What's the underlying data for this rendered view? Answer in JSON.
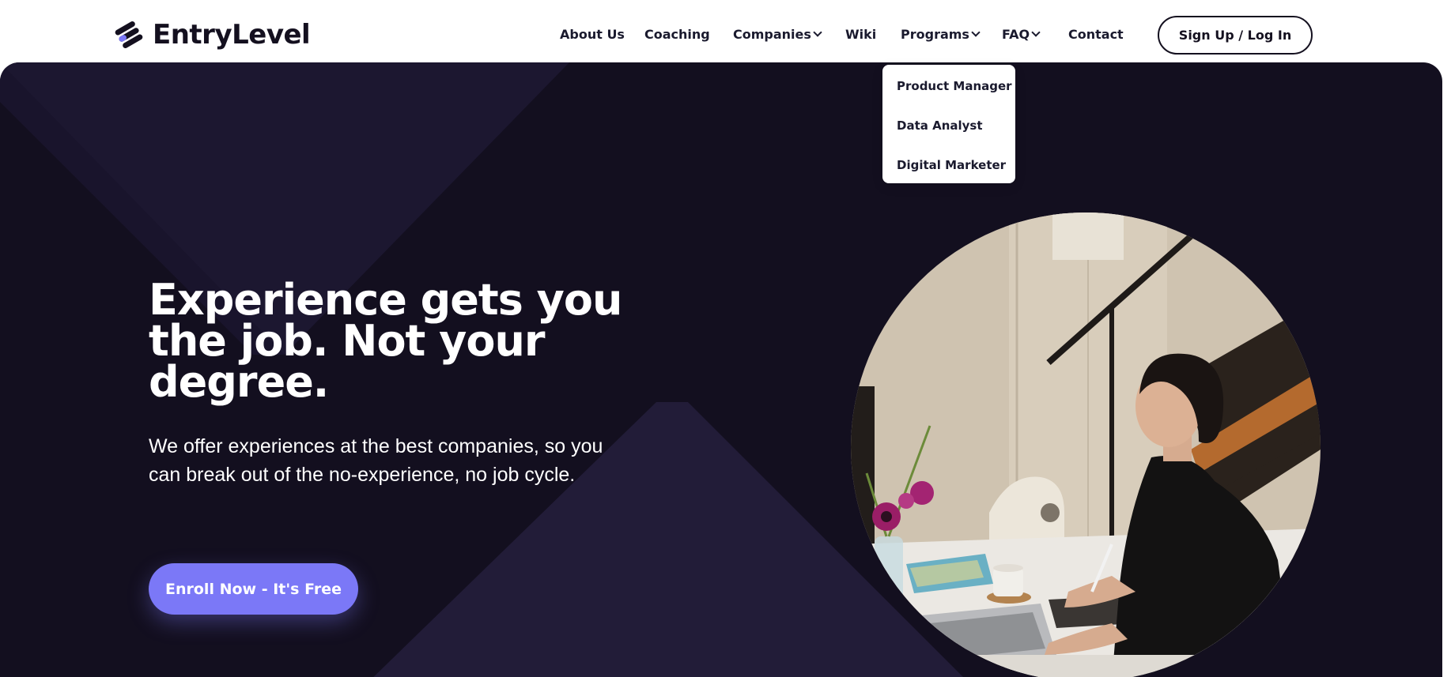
{
  "brand": {
    "name": "EntryLevel"
  },
  "nav": {
    "items": [
      {
        "label": "About Us",
        "has_dropdown": false
      },
      {
        "label": "Coaching",
        "has_dropdown": false
      },
      {
        "label": "Companies",
        "has_dropdown": true
      },
      {
        "label": "Wiki",
        "has_dropdown": false
      },
      {
        "label": "Programs",
        "has_dropdown": true
      },
      {
        "label": "FAQ",
        "has_dropdown": true
      },
      {
        "label": "Contact",
        "has_dropdown": false
      }
    ],
    "signup_label": "Sign Up / Log In"
  },
  "programs_dropdown": {
    "items": [
      "Product Manager",
      "Data Analyst",
      "Digital Marketer"
    ]
  },
  "hero": {
    "headline": "Experience gets you the job. Not your degree.",
    "subtext": "We offer experiences at the best companies, so you can break out of the no-experience, no job cycle.",
    "cta_label": "Enroll Now - It's Free"
  },
  "colors": {
    "hero_background": "#130f1f",
    "accent": "#7b78f7",
    "text_dark": "#14101f",
    "text_light": "#ffffff"
  },
  "icons": {
    "logo": "entrylevel-logo-icon",
    "dropdown": "chevron-down-icon"
  }
}
